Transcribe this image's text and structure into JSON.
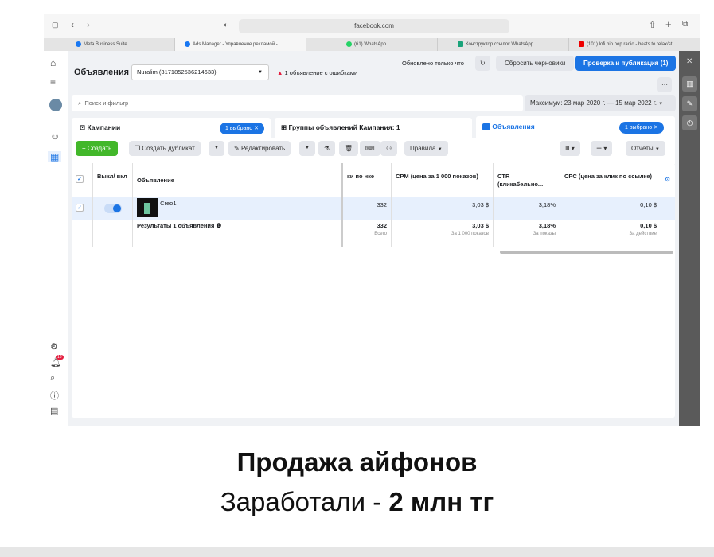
{
  "browser": {
    "url": "facebook.com",
    "tabs": [
      "Meta Business Suite",
      "Ads Manager - Управление рекламой -...",
      "(61) WhatsApp",
      "Конструктор ссылок WhatsApp",
      "(101) lofi hip hop radio - beats to relax/st..."
    ]
  },
  "header": {
    "title": "Объявления",
    "account": "Nuralim (3171852536214633)",
    "error": "1 объявление с ошибками",
    "updated": "Обновлено только что",
    "reset": "Сбросить черновики",
    "publish": "Проверка и публикация (1)"
  },
  "search": {
    "placeholder": "Поиск и фильтр",
    "date_range": "Максимум: 23 мар 2020 г. — 15 мар 2022 г."
  },
  "levels": {
    "campaigns": "Кампании",
    "campaigns_sel": "1 выбрано ✕",
    "adsets": "Группы объявлений Кампания: 1",
    "ads": "Объявления",
    "ads_sel": "1 выбрано ✕"
  },
  "toolbar": {
    "create": "+ Создать",
    "duplicate": "Создать дубликат",
    "edit": "Редактировать",
    "rules": "Правила",
    "reports": "Отчеты"
  },
  "table": {
    "headers": {
      "toggle": "Выкл/ вкл",
      "ad": "Объявление",
      "clicks": "ки по нке",
      "cpm": "CPM (цена за 1 000 показов)",
      "ctr": "CTR (кликабельно...",
      "cpc": "CPC (цена за клик по ссылке)"
    },
    "row": {
      "name": "Creo1",
      "clicks": "332",
      "cpm": "3,03 $",
      "ctr": "3,18%",
      "cpc": "0,10 $",
      "active": true
    },
    "totals": {
      "label": "Результаты 1 объявления",
      "clicks": "332",
      "clicks_sub": "Всего",
      "cpm": "3,03 $",
      "cpm_sub": "За 1 000 показов",
      "ctr": "3,18%",
      "ctr_sub": "За показы",
      "cpc": "0,10 $",
      "cpc_sub": "За действие"
    }
  },
  "notifications_badge": "18",
  "caption": {
    "line1": "Продажа айфонов",
    "line2_prefix": "Заработали - ",
    "line2_bold": "2 млн тг"
  }
}
